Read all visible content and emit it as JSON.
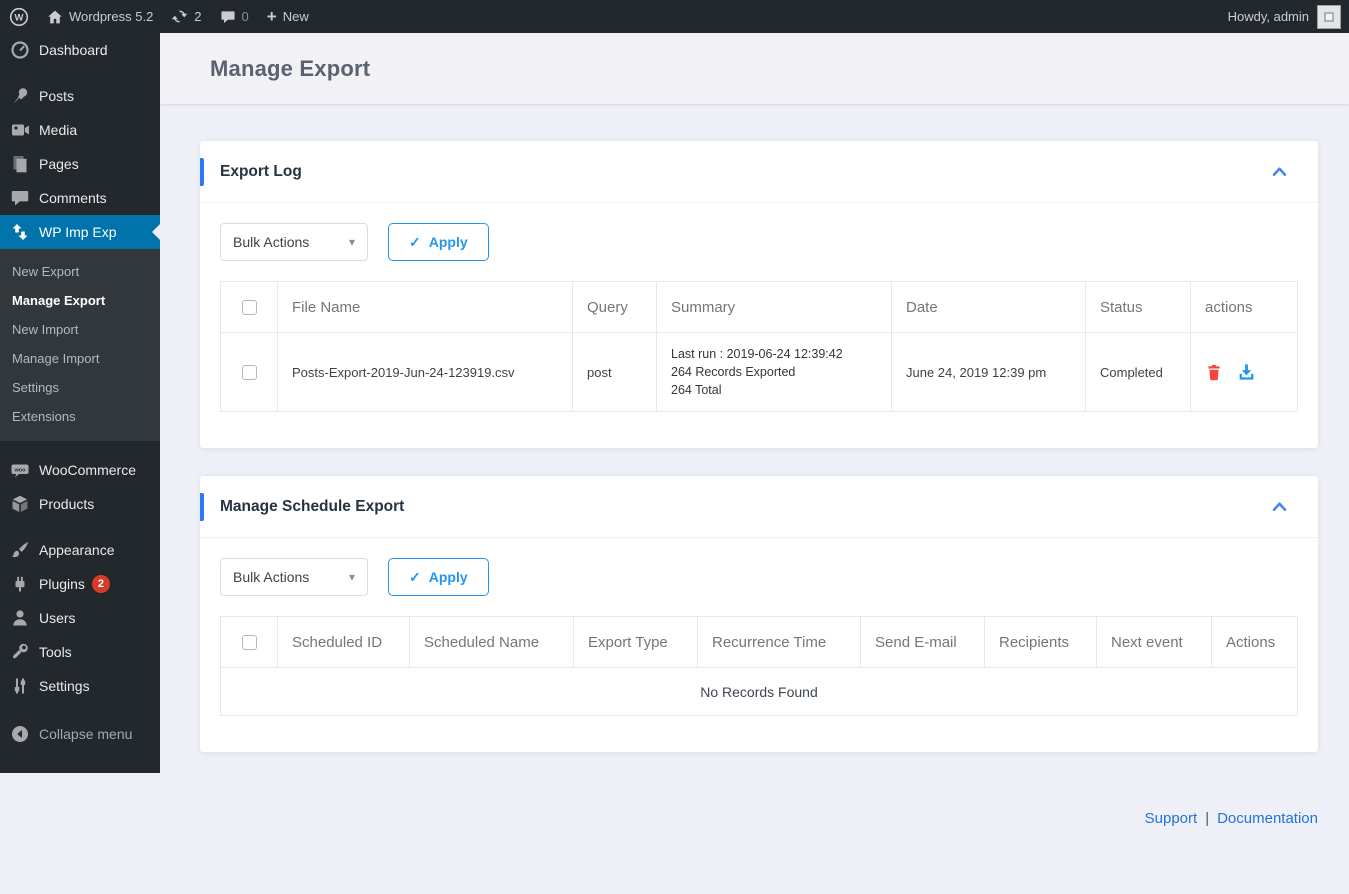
{
  "admin_bar": {
    "site_name": "Wordpress 5.2",
    "update_count": "2",
    "comment_count": "0",
    "new_label": "New",
    "howdy": "Howdy, admin"
  },
  "icons": {
    "plus": "+",
    "caret": "▾",
    "check": "✓",
    "wp_letter": "W"
  },
  "sidebar": {
    "items": [
      {
        "label": "Dashboard"
      },
      {
        "label": "Posts"
      },
      {
        "label": "Media"
      },
      {
        "label": "Pages"
      },
      {
        "label": "Comments"
      },
      {
        "label": "WP Imp Exp"
      },
      {
        "label": "WooCommerce"
      },
      {
        "label": "Products"
      },
      {
        "label": "Appearance"
      },
      {
        "label": "Plugins"
      },
      {
        "label": "Users"
      },
      {
        "label": "Tools"
      },
      {
        "label": "Settings"
      },
      {
        "label": "Collapse menu"
      }
    ],
    "plugins_badge": "2",
    "submenu": [
      "New Export",
      "Manage Export",
      "New Import",
      "Manage Import",
      "Settings",
      "Extensions"
    ]
  },
  "page": {
    "title": "Manage Export"
  },
  "export_log": {
    "title": "Export Log",
    "bulk_actions_label": "Bulk Actions",
    "apply_label": "Apply",
    "columns": [
      "File Name",
      "Query",
      "Summary",
      "Date",
      "Status",
      "actions"
    ],
    "rows": [
      {
        "file_name": "Posts-Export-2019-Jun-24-123919.csv",
        "query": "post",
        "summary_lines": [
          "Last run : 2019-06-24 12:39:42",
          "264 Records Exported",
          "264 Total"
        ],
        "date": "June 24, 2019 12:39 pm",
        "status": "Completed"
      }
    ]
  },
  "schedule_export": {
    "title": "Manage Schedule Export",
    "bulk_actions_label": "Bulk Actions",
    "apply_label": "Apply",
    "columns": [
      "Scheduled ID",
      "Scheduled Name",
      "Export Type",
      "Recurrence Time",
      "Send E-mail",
      "Recipients",
      "Next event",
      "Actions"
    ],
    "empty_message": "No Records Found"
  },
  "footer": {
    "support": "Support",
    "separator": "|",
    "documentation": "Documentation"
  },
  "colors": {
    "active_menu": "#0073aa",
    "accent_blue": "#3079f6",
    "apply_blue": "#2196f3",
    "trash_red": "#f5453c",
    "download_blue": "#2196f3",
    "badge_red": "#d63d27",
    "content_bg": "#eff0f7",
    "admin_dark": "#23282d"
  }
}
